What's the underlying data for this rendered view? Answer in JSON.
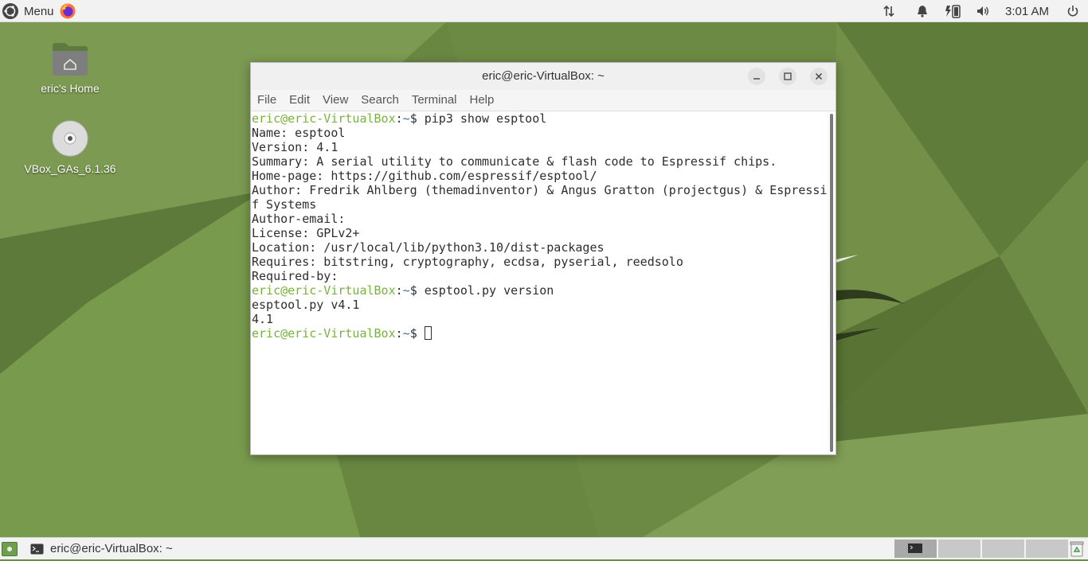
{
  "top_panel": {
    "menu_label": "Menu",
    "clock": "3:01 AM",
    "icons": [
      "ubuntu-logo-icon",
      "firefox-icon",
      "network-icon",
      "notification-bell-icon",
      "battery-icon",
      "volume-icon",
      "power-icon"
    ]
  },
  "desktop": {
    "icons": [
      {
        "label": "eric's Home",
        "icon": "home-folder-icon"
      },
      {
        "label": "VBox_GAs_6.1.36",
        "icon": "cd-disc-icon"
      }
    ]
  },
  "terminal": {
    "title": "eric@eric-VirtualBox: ~",
    "menu": [
      "File",
      "Edit",
      "View",
      "Search",
      "Terminal",
      "Help"
    ],
    "prompt_user": "eric@eric-VirtualBox",
    "prompt_path": "~",
    "prompt_symbol": "$",
    "lines": [
      {
        "type": "cmd",
        "text": "pip3 show esptool"
      },
      {
        "type": "out",
        "text": "Name: esptool"
      },
      {
        "type": "out",
        "text": "Version: 4.1"
      },
      {
        "type": "out",
        "text": "Summary: A serial utility to communicate & flash code to Espressif chips."
      },
      {
        "type": "out",
        "text": "Home-page: https://github.com/espressif/esptool/"
      },
      {
        "type": "out",
        "text": "Author: Fredrik Ahlberg (themadinventor) & Angus Gratton (projectgus) & Espressi"
      },
      {
        "type": "out",
        "text": "f Systems"
      },
      {
        "type": "out",
        "text": "Author-email: "
      },
      {
        "type": "out",
        "text": "License: GPLv2+"
      },
      {
        "type": "out",
        "text": "Location: /usr/local/lib/python3.10/dist-packages"
      },
      {
        "type": "out",
        "text": "Requires: bitstring, cryptography, ecdsa, pyserial, reedsolo"
      },
      {
        "type": "out",
        "text": "Required-by: "
      },
      {
        "type": "cmd",
        "text": "esptool.py version"
      },
      {
        "type": "out",
        "text": "esptool.py v4.1"
      },
      {
        "type": "out",
        "text": "4.1"
      },
      {
        "type": "cmd",
        "text": "",
        "cursor": true
      }
    ]
  },
  "taskbar": {
    "window_label": "eric@eric-VirtualBox: ~",
    "workspaces": 4
  },
  "colors": {
    "prompt_user": "#77b33b",
    "prompt_path": "#3f6ea8",
    "wallpaper": "#6f8c45"
  }
}
